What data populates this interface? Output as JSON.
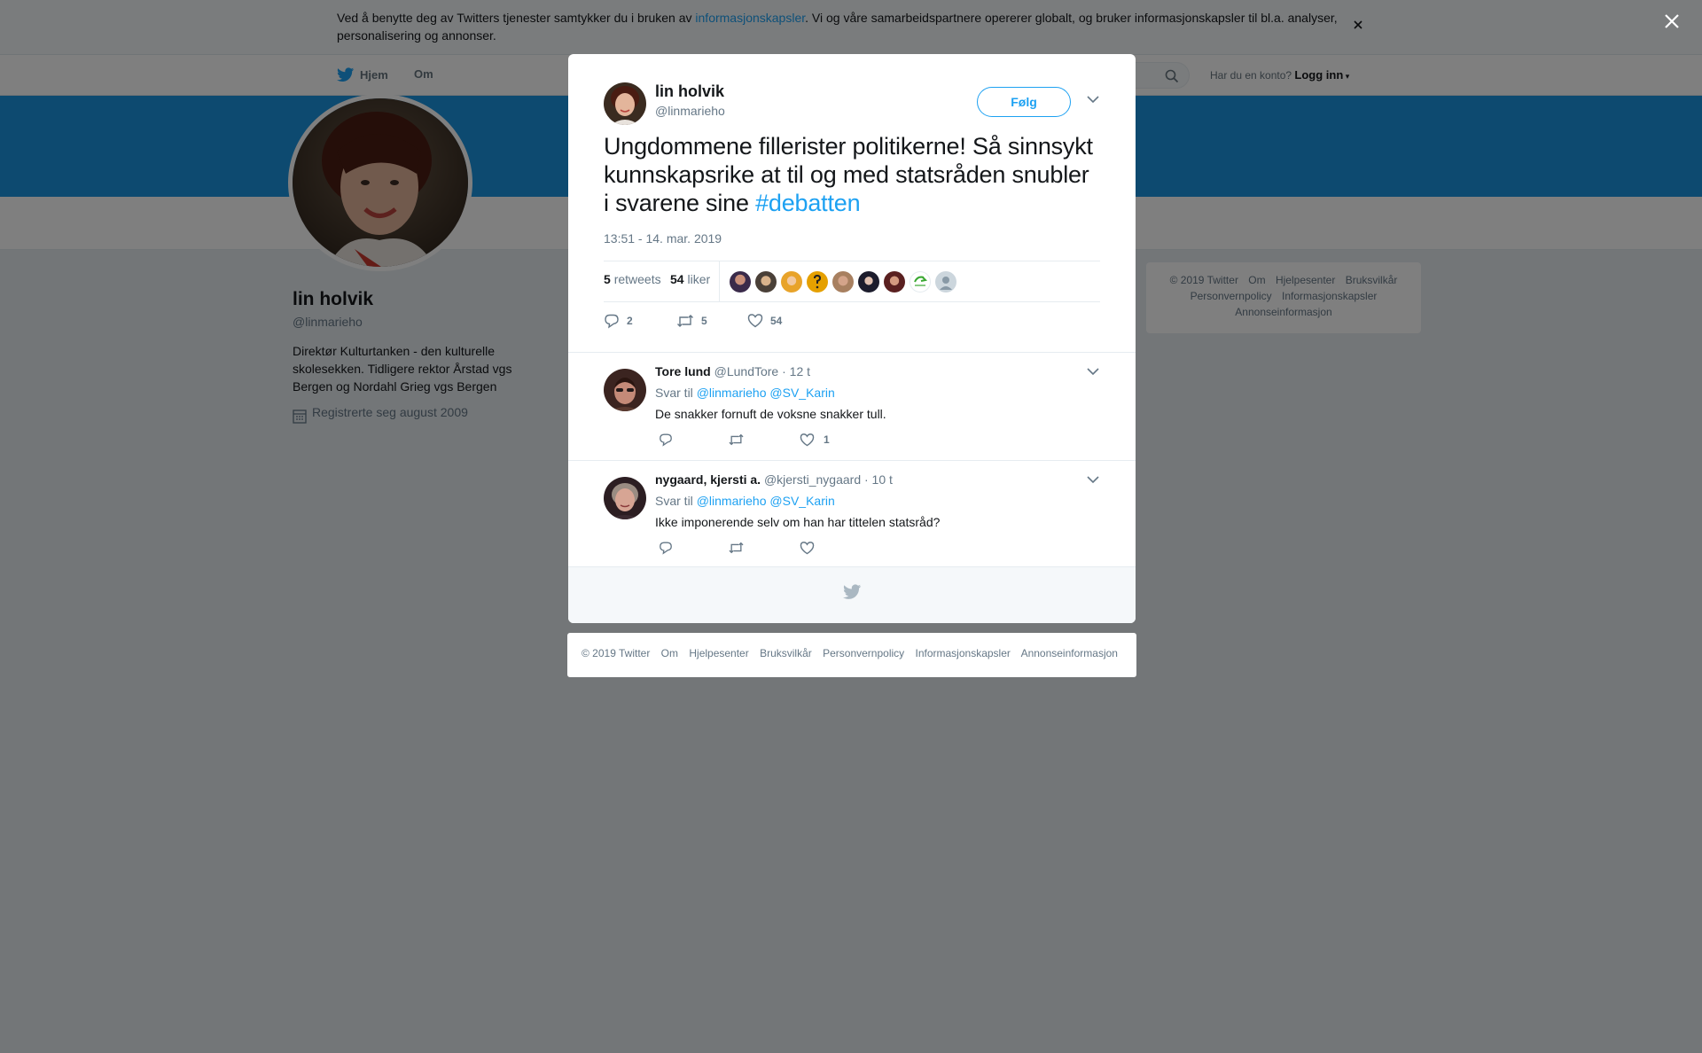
{
  "cookie_banner": {
    "text_before": "Ved å benytte deg av Twitters tjenester samtykker du i bruken av ",
    "link": "informasjonskapsler",
    "text_after": ". Vi og våre samarbeidspartnere opererer globalt, og bruker informasjonskapsler til bl.a. analyser, personalisering og annonser."
  },
  "nav": {
    "home": "Hjem",
    "about": "Om",
    "login_prompt": "Har du en konto?",
    "login": "Logg inn"
  },
  "profile": {
    "name": "lin holvik",
    "handle": "@linmarieho",
    "bio": "Direktør Kulturtanken - den kulturelle skolesekken. Tidligere rektor Årstad vgs Bergen og Nordahl Grieg vgs Bergen",
    "joined": "Registrerte seg august 2009"
  },
  "side_footer": [
    "© 2019 Twitter",
    "Om",
    "Hjelpesenter",
    "Bruksvilkår",
    "Personvernpolicy",
    "Informasjonskapsler",
    "Annonseinformasjon"
  ],
  "tweet": {
    "author_name": "lin holvik",
    "author_handle": "@linmarieho",
    "follow_label": "Følg",
    "text": "Ungdommene fillerister politikerne! Så sinnsykt kunnskapsrike at til og med statsråden snubler i svarene sine ",
    "hashtag": "#debatten",
    "timestamp": "13:51 - 14. mar. 2019",
    "retweets_count": "5",
    "retweets_label": "retweets",
    "likes_count": "54",
    "likes_label": "liker",
    "action_replies": "2",
    "action_retweets": "5",
    "action_likes": "54"
  },
  "replies": [
    {
      "name": "Tore lund",
      "handle": "@LundTore",
      "time": "· 12 t",
      "reply_to_label": "Svar til",
      "mention1": "@linmarieho",
      "mention2": "@SV_Karin",
      "text": "De snakker fornuft de voksne snakker tull.",
      "likes": "1"
    },
    {
      "name": "nygaard, kjersti a.",
      "handle": "@kjersti_nygaard",
      "time": "· 10 t",
      "reply_to_label": "Svar til",
      "mention1": "@linmarieho",
      "mention2": "@SV_Karin",
      "text": "Ikke imponerende selv om han har tittelen statsråd?",
      "likes": ""
    }
  ],
  "modal_footer": [
    "© 2019 Twitter",
    "Om",
    "Hjelpesenter",
    "Bruksvilkår",
    "Personvernpolicy",
    "Informasjonskapsler",
    "Annonseinformasjon"
  ],
  "colors": {
    "accent": "#1da1f2",
    "banner": "#1b95e0",
    "overlay": "rgba(0,0,0,0.5)"
  },
  "icons": [
    "twitter-bird-icon",
    "search-icon",
    "close-icon",
    "calendar-icon",
    "chevron-down-icon",
    "reply-icon",
    "retweet-icon",
    "like-icon"
  ]
}
